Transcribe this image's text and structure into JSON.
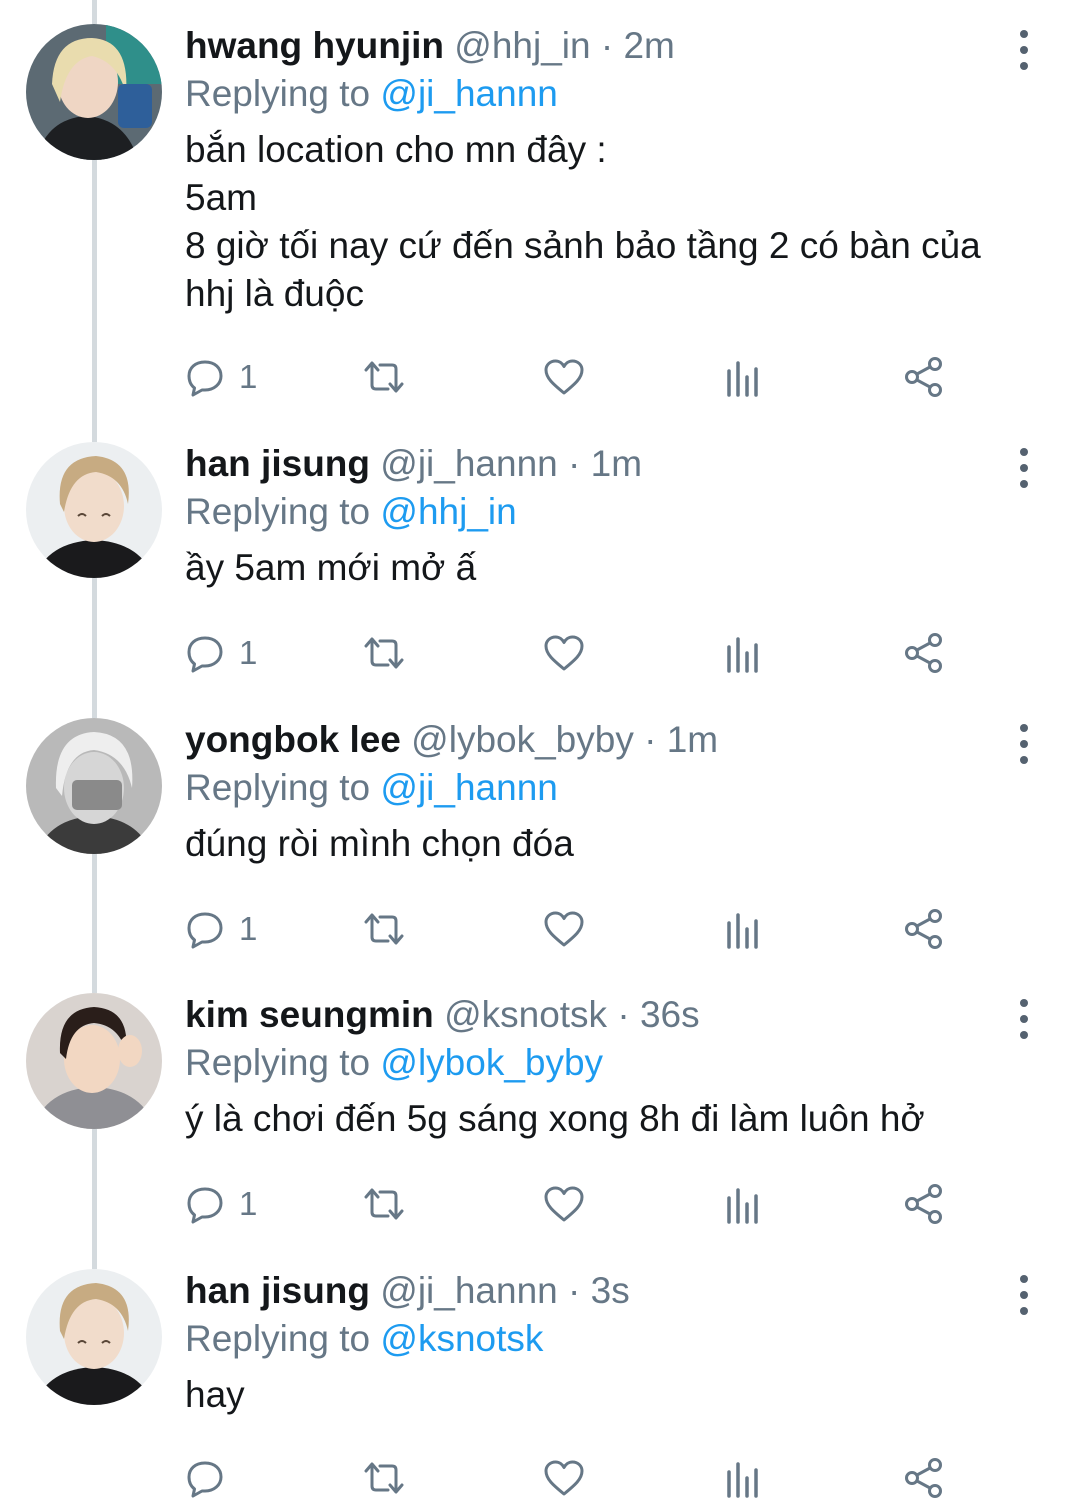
{
  "colors": {
    "mention": "#1d9bf0",
    "muted": "#667786",
    "text": "#14171a",
    "thread_line": "#d4dade"
  },
  "icons": {
    "reply": "speech-bubble-icon",
    "retweet": "retweet-arrows-icon",
    "like": "heart-outline-icon",
    "views": "bar-chart-icon",
    "share": "share-nodes-icon",
    "more": "vertical-dots-icon"
  },
  "tweets": [
    {
      "name": "hwang hyunjin",
      "handle": "@hhj_in",
      "dot": "·",
      "time": "2m",
      "reply_prefix": "Replying to",
      "reply_to": "@ji_hannn",
      "text": "bắn location cho mn đây :\n5am\n8 giờ tối nay cứ đến sảnh bảo tầng 2 có bàn của hhj là đuộc",
      "reply_count": "1"
    },
    {
      "name": "han jisung",
      "handle": "@ji_hannn",
      "dot": "·",
      "time": "1m",
      "reply_prefix": "Replying to",
      "reply_to": "@hhj_in",
      "text": "ầy 5am mới mở ấ",
      "reply_count": "1"
    },
    {
      "name": "yongbok lee",
      "handle": "@lybok_byby",
      "dot": "·",
      "time": "1m",
      "reply_prefix": "Replying to",
      "reply_to": "@ji_hannn",
      "text": "đúng ròi mình chọn đóa",
      "reply_count": "1"
    },
    {
      "name": "kim seungmin",
      "handle": "@ksnotsk",
      "dot": "·",
      "time": "36s",
      "reply_prefix": "Replying to",
      "reply_to": "@lybok_byby",
      "text": "ý là chơi đến 5g sáng xong 8h đi làm luôn hở",
      "reply_count": "1"
    },
    {
      "name": "han jisung",
      "handle": "@ji_hannn",
      "dot": "·",
      "time": "3s",
      "reply_prefix": "Replying to",
      "reply_to": "@ksnotsk",
      "text": "hay",
      "reply_count": ""
    }
  ]
}
